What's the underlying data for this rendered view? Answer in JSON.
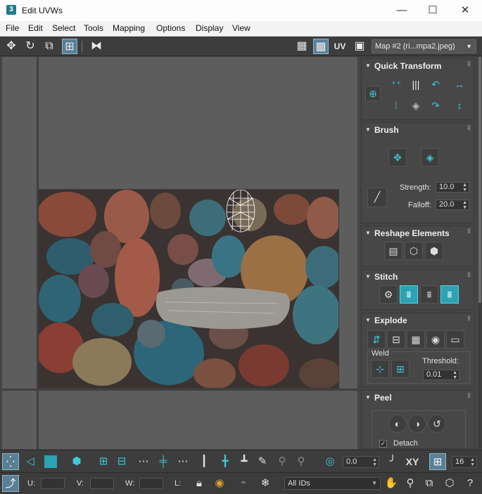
{
  "window": {
    "app_icon": "3",
    "title": "Edit UVWs",
    "controls": {
      "minimize": "—",
      "maximize": "☐",
      "close": "✕"
    }
  },
  "menubar": [
    "File",
    "Edit",
    "Select",
    "Tools",
    "Mapping",
    "Options",
    "Display",
    "View"
  ],
  "toolbar": {
    "uv_label": "UV",
    "map_dropdown": "Map #2 (ri...mpa2.jpeg)"
  },
  "panel": {
    "quick_transform": {
      "title": "Quick Transform"
    },
    "brush": {
      "title": "Brush",
      "strength_label": "Strength:",
      "strength_value": "10.0",
      "falloff_label": "Falloff:",
      "falloff_value": "20.0"
    },
    "reshape": {
      "title": "Reshape Elements"
    },
    "stitch": {
      "title": "Stitch"
    },
    "explode": {
      "title": "Explode",
      "weld_label": "Weld",
      "threshold_label": "Threshold:",
      "threshold_value": "0.01"
    },
    "peel": {
      "title": "Peel",
      "detach_label": "Detach",
      "detach_checked": true
    }
  },
  "bottom": {
    "rotate_value": "0.0",
    "xy_label": "XY",
    "grid_value": "16",
    "u_label": "U:",
    "v_label": "V:",
    "w_label": "W:",
    "l_label": "L:",
    "ids_dropdown": "All IDs"
  },
  "colors": {
    "accent": "#3fc7d6",
    "highlight": "#5b7f95",
    "viewport_bg": "#5d5d5d",
    "panel_bg": "#444444"
  }
}
